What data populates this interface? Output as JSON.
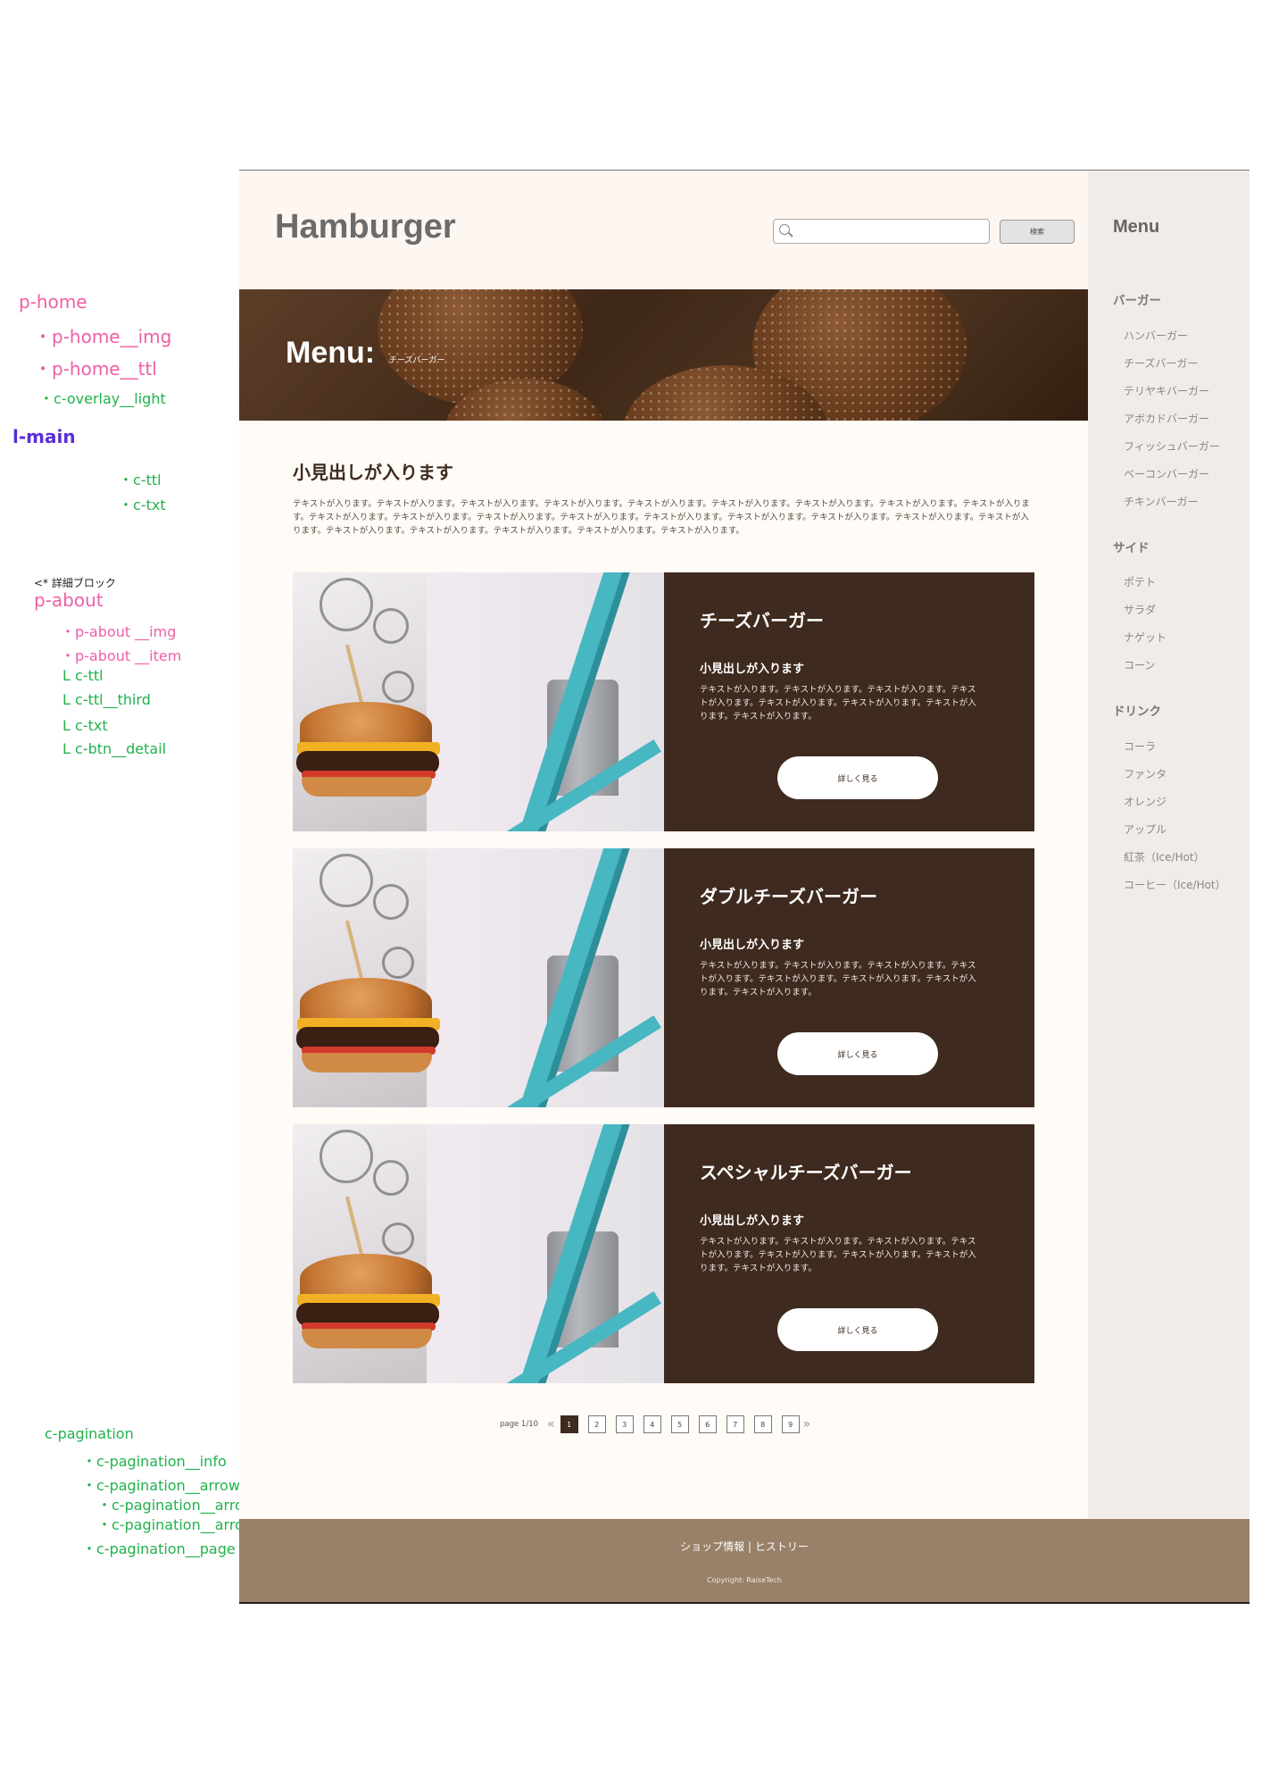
{
  "annotations": {
    "home": [
      "p-home",
      "・p-home__img",
      "・p-home__ttl",
      "・c-overlay__light"
    ],
    "main": [
      "l-main",
      "・c-ttl",
      "・c-txt"
    ],
    "about_comment": "<* 詳細ブロック",
    "about": [
      "p-about",
      "・p-about __img",
      "・p-about __item",
      "L  c-ttl",
      "L  c-ttl__third",
      "L  c-txt",
      "L  c-btn__detail"
    ],
    "pagination": [
      "c-pagination",
      "・c-pagination__info",
      "・c-pagination__arrow",
      "・c-pagination__arrow-prev",
      "・c-pagination__arrow-next",
      "・c-pagination__page"
    ]
  },
  "header": {
    "logo": "Hamburger",
    "search_placeholder": "",
    "search_button": "検索"
  },
  "hero": {
    "title": "Menu:",
    "subtitle": "チーズバーガー"
  },
  "main": {
    "title": "小見出しが入ります",
    "text": "テキストが入ります。テキストが入ります。テキストが入ります。テキストが入ります。テキストが入ります。テキストが入ります。テキストが入ります。テキストが入ります。テキストが入ります。テキストが入ります。テキストが入ります。テキストが入ります。テキストが入ります。テキストが入ります。テキストが入ります。テキストが入ります。テキストが入ります。テキストが入ります。テキストが入ります。テキストが入ります。テキストが入ります。テキストが入ります。テキストが入ります。"
  },
  "cards": [
    {
      "title": "チーズバーガー",
      "subtitle": "小見出しが入ります",
      "text": "テキストが入ります。テキストが入ります。テキストが入ります。テキストが入ります。テキストが入ります。テキストが入ります。テキストが入ります。テキストが入ります。",
      "button": "詳しく見る"
    },
    {
      "title": "ダブルチーズバーガー",
      "subtitle": "小見出しが入ります",
      "text": "テキストが入ります。テキストが入ります。テキストが入ります。テキストが入ります。テキストが入ります。テキストが入ります。テキストが入ります。テキストが入ります。",
      "button": "詳しく見る"
    },
    {
      "title": "スペシャルチーズバーガー",
      "subtitle": "小見出しが入ります",
      "text": "テキストが入ります。テキストが入ります。テキストが入ります。テキストが入ります。テキストが入ります。テキストが入ります。テキストが入ります。テキストが入ります。",
      "button": "詳しく見る"
    }
  ],
  "pagination": {
    "info": "page 1/10",
    "prev": "«",
    "next": "»",
    "pages": [
      "1",
      "2",
      "3",
      "4",
      "5",
      "6",
      "7",
      "8",
      "9"
    ],
    "current": "1"
  },
  "sidebar": {
    "title": "Menu",
    "categories": [
      {
        "name": "バーガー",
        "items": [
          "ハンバーガー",
          "チーズバーガー",
          "テリヤキバーガー",
          "アボカドバーガー",
          "フィッシュバーガー",
          "ベーコンバーガー",
          "チキンバーガー"
        ]
      },
      {
        "name": "サイド",
        "items": [
          "ポテト",
          "サラダ",
          "ナゲット",
          "コーン"
        ]
      },
      {
        "name": "ドリンク",
        "items": [
          "コーラ",
          "ファンタ",
          "オレンジ",
          "アップル",
          "紅茶（Ice/Hot）",
          "コーヒー（Ice/Hot）"
        ]
      }
    ]
  },
  "footer": {
    "links": "ショップ情報 | ヒストリー",
    "copyright": "Copyright: RaiseTech"
  },
  "colors": {
    "header_bg": "#fdf6f1",
    "panel_bg": "#3e2a1e",
    "sidebar_bg": "#f1ece8",
    "footer_bg": "#998068",
    "annotation_pink": "#ef5fa7",
    "annotation_green": "#22b14c",
    "annotation_purple": "#5a2dd6"
  }
}
